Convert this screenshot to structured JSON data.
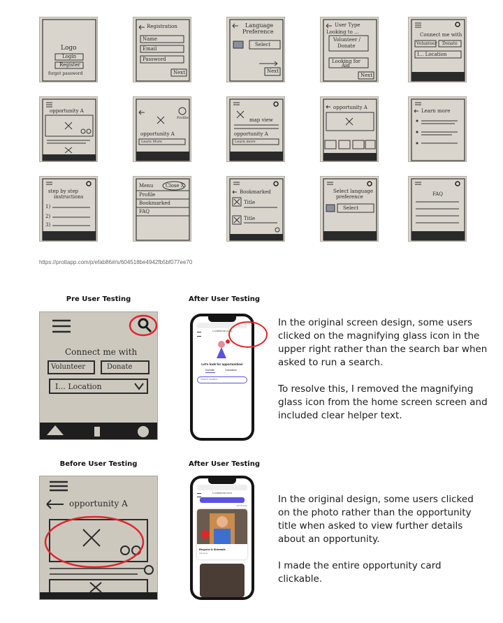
{
  "sketches": {
    "row1": {
      "s1": {
        "logo": "Logo",
        "login": "Login",
        "register": "Register",
        "forgot": "forget password"
      },
      "s2": {
        "title": "Registration",
        "name": "Name",
        "email": "Email",
        "password": "Password",
        "next": "Next"
      },
      "s3": {
        "title_1": "Language",
        "title_2": "Preference",
        "select": "Select",
        "next": "Next"
      },
      "s4": {
        "title": "User Type",
        "looking": "Looking to ...",
        "option_1": "Volunteer /",
        "option_2": "Donate",
        "looking_for_1": "Looking for",
        "looking_for_2": "Aid",
        "next": "Next"
      },
      "s5": {
        "connect": "Connect me with",
        "volunteer": "Volunteer",
        "donate": "Donate",
        "location": "I... Location"
      }
    },
    "row2": {
      "s6": {
        "title": "opportunity A"
      },
      "s7": {
        "title": "opportunity A",
        "profile": "Profile",
        "learn": "Learn More"
      },
      "s8": {
        "map": "map view",
        "title": "opportunity A",
        "learn": "Learn more"
      },
      "s9": {
        "title": "opportunity A"
      },
      "s10": {
        "title": "Learn more"
      }
    },
    "row3": {
      "s11": {
        "title_1": "step by step",
        "title_2": "instructions",
        "i1": "1)",
        "i2": "2)",
        "i3": "3)"
      },
      "s12": {
        "menu": "Menu",
        "close": "Close X",
        "profile": "Profile",
        "bookmarked": "Bookmarked",
        "faq": "FAQ"
      },
      "s13": {
        "title": "Bookmarked",
        "t1": "Title",
        "t2": "Title"
      },
      "s14": {
        "title_1": "Select language",
        "title_2": "preference",
        "select": "Select"
      },
      "s15": {
        "title": "FAQ"
      }
    }
  },
  "prototype_url": "https://prottapp.com/p/efab86#/s/604518be4942fb5bf077ee70",
  "comparison_1": {
    "left_heading": "Pre User Testing",
    "right_heading": "After User Testing",
    "photo": {
      "connect": "Connect me with",
      "volunteer": "Volunteer",
      "donate": "Donate",
      "location": "I... Location"
    },
    "phone": {
      "url": "Lookforme.com",
      "tagline": "Let's look for opportunities!",
      "tab_1": "Donate",
      "tab_2": "Volunteer",
      "search_placeholder": "Search location..."
    },
    "paragraph_1": "In the original screen design, some users clicked on the magnifying glass icon in the upper right rather than the search bar when asked to run a search.",
    "paragraph_2": "To resolve this,  I removed the magnifying glass icon from the home screen screen and included clear helper text."
  },
  "comparison_2": {
    "left_heading": "Before User Testing",
    "right_heading": "After User Testing",
    "photo": {
      "title": "opportunity A"
    },
    "phone": {
      "url": "Lookforme.com",
      "header": "Search Results",
      "count": "100 Results",
      "card_title": "Request A Sidewalk",
      "card_sub": "Volunteer"
    },
    "paragraph_1": "In the original design, some users clicked on the photo rather than the opportunity title when asked to view further details about an opportunity.",
    "paragraph_2": "I made the  entire opportunity card clickable."
  },
  "colors": {
    "annotation_red": "#e0262b",
    "phone_accent": "#5b52e0",
    "paper": "#d9d5cd"
  }
}
